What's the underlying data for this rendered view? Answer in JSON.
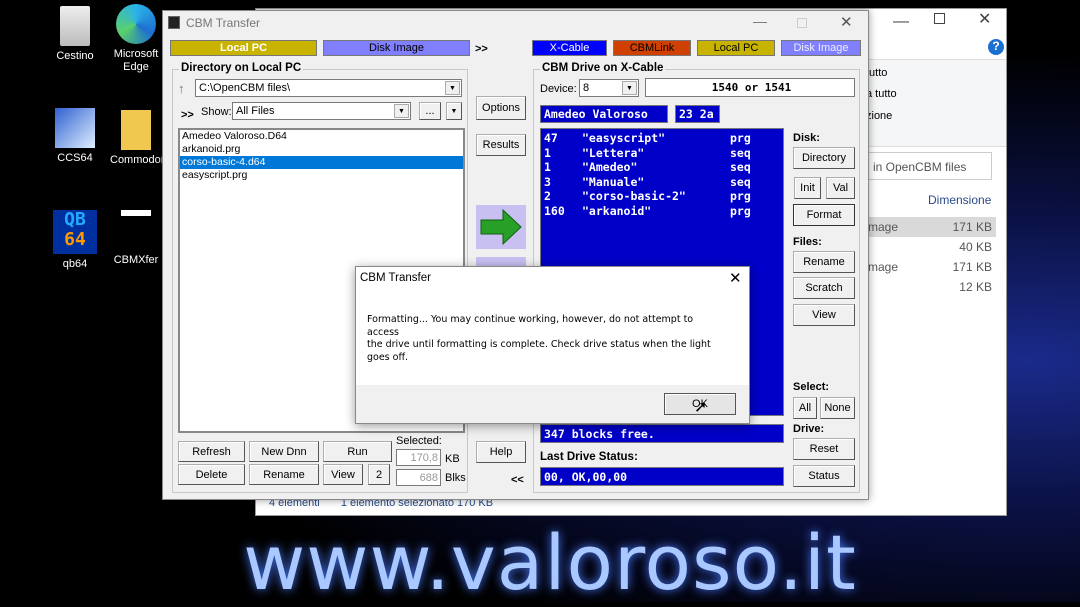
{
  "desktop": {
    "icons": [
      {
        "label": "Cestino"
      },
      {
        "label": "Microsoft Edge"
      },
      {
        "label": "CCS64"
      },
      {
        "label": "Commodore"
      },
      {
        "label": "qb64"
      },
      {
        "label": "CBMXfer"
      }
    ]
  },
  "explorer": {
    "ribbon": [
      "tutto",
      "a tutto",
      "zione",
      "a"
    ],
    "search_placeholder": "in OpenCBM files",
    "col_size": "Dimensione",
    "rows": [
      {
        "type": "mage",
        "size": "171 KB"
      },
      {
        "type": "",
        "size": "40 KB"
      },
      {
        "type": "mage",
        "size": "171 KB"
      },
      {
        "type": "",
        "size": "12 KB"
      }
    ],
    "status_count": "4 elementi",
    "status_selected": "1 elemento selezionato  170 KB"
  },
  "window": {
    "title": "CBM Transfer"
  },
  "left_tabs": [
    {
      "label": "Local PC",
      "color": "#c8b400"
    },
    {
      "label": "Disk Image",
      "color": "#8080ff"
    }
  ],
  "right_tabs": [
    {
      "label": "X-Cable",
      "color": "#0000ff"
    },
    {
      "label": "CBMLink",
      "color": "#d04000"
    },
    {
      "label": "Local PC",
      "color": "#c8b400"
    },
    {
      "label": "Disk Image",
      "color": "#8080ff"
    }
  ],
  "tab_arrow": ">>",
  "local": {
    "title": "Directory on Local PC",
    "path": "C:\\OpenCBM files\\",
    "show_label": "Show:",
    "show_value": "All Files",
    "browse": "...",
    "expand": ">>",
    "files": [
      "Amedeo Valoroso.D64",
      "arkanoid.prg",
      "corso-basic-4.d64",
      "easyscript.prg"
    ],
    "selected_index": 2,
    "buttons": {
      "refresh": "Refresh",
      "new_dnn": "New Dnn",
      "run": "Run",
      "delete": "Delete",
      "rename": "Rename",
      "view": "View",
      "two": "2"
    },
    "selected_label": "Selected:",
    "kb": "170,8",
    "kb_unit": "KB",
    "blks": "688",
    "blks_unit": "Blks"
  },
  "middle": {
    "options": "Options",
    "results": "Results",
    "help": "Help",
    "back": "<<"
  },
  "drive": {
    "title": "CBM Drive on X-Cable",
    "device_label": "Device:",
    "device": "8",
    "model": "1540 or 1541",
    "disk_name": "Amedeo Valoroso",
    "disk_id": "23 2a",
    "files": [
      {
        "blocks": "47",
        "name": "\"easyscript\"",
        "type": "prg"
      },
      {
        "blocks": "1",
        "name": "\"Lettera\"",
        "type": "seq"
      },
      {
        "blocks": "1",
        "name": "\"Amedeo\"",
        "type": "seq"
      },
      {
        "blocks": "3",
        "name": "\"Manuale\"",
        "type": "seq"
      },
      {
        "blocks": "2",
        "name": "\"corso-basic-2\"",
        "type": "prg"
      },
      {
        "blocks": "160",
        "name": "\"arkanoid\"",
        "type": "prg"
      }
    ],
    "free": "347 blocks free.",
    "status_label": "Last Drive Status:",
    "status": "00, OK,00,00"
  },
  "side": {
    "disk": "Disk:",
    "directory": "Directory",
    "init": "Init",
    "val": "Val",
    "format": "Format",
    "files": "Files:",
    "rename": "Rename",
    "scratch": "Scratch",
    "view": "View",
    "select": "Select:",
    "all": "All",
    "none": "None",
    "drive": "Drive:",
    "reset": "Reset",
    "status": "Status"
  },
  "dialog": {
    "title": "CBM Transfer",
    "message": "Formatting... You may continue working, however, do not attempt to access\nthe drive until formatting is complete. Check drive status when the light goes off.",
    "ok": "OK"
  },
  "watermark": "www.valoroso.it"
}
